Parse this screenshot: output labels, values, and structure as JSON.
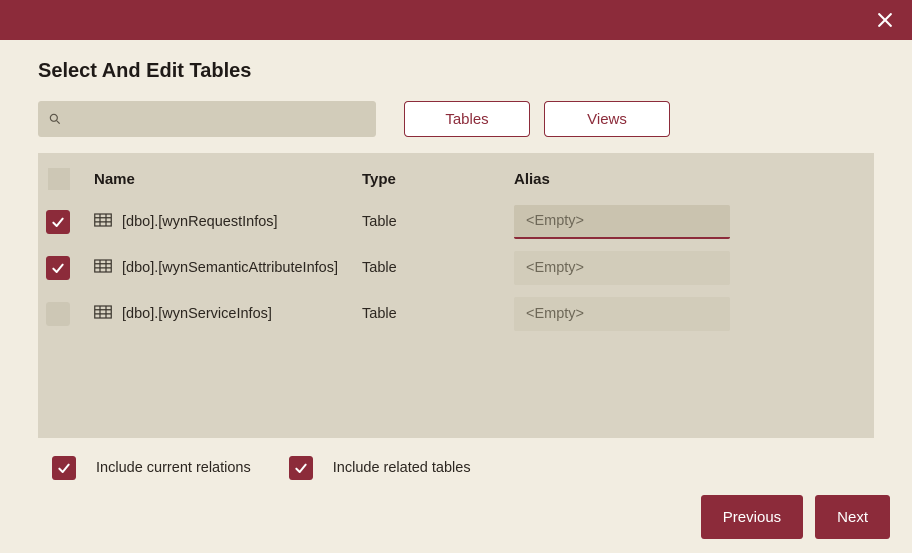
{
  "title": "Select And Edit Tables",
  "search": {
    "placeholder": ""
  },
  "typeButtons": {
    "tables": "Tables",
    "views": "Views"
  },
  "columns": {
    "name": "Name",
    "type": "Type",
    "alias": "Alias"
  },
  "rows": [
    {
      "checked": true,
      "name": "[dbo].[wynRequestInfos]",
      "type": "Table",
      "alias": "",
      "aliasPlaceholder": "<Empty>",
      "focused": true
    },
    {
      "checked": true,
      "name": "[dbo].[wynSemanticAttributeInfos]",
      "type": "Table",
      "alias": "",
      "aliasPlaceholder": "<Empty>",
      "focused": false
    },
    {
      "checked": false,
      "name": "[dbo].[wynServiceInfos]",
      "type": "Table",
      "alias": "",
      "aliasPlaceholder": "<Empty>",
      "focused": false
    }
  ],
  "options": {
    "includeRelations": {
      "label": "Include current relations",
      "checked": true
    },
    "includeRelated": {
      "label": "Include related tables",
      "checked": true
    }
  },
  "footer": {
    "previous": "Previous",
    "next": "Next"
  }
}
